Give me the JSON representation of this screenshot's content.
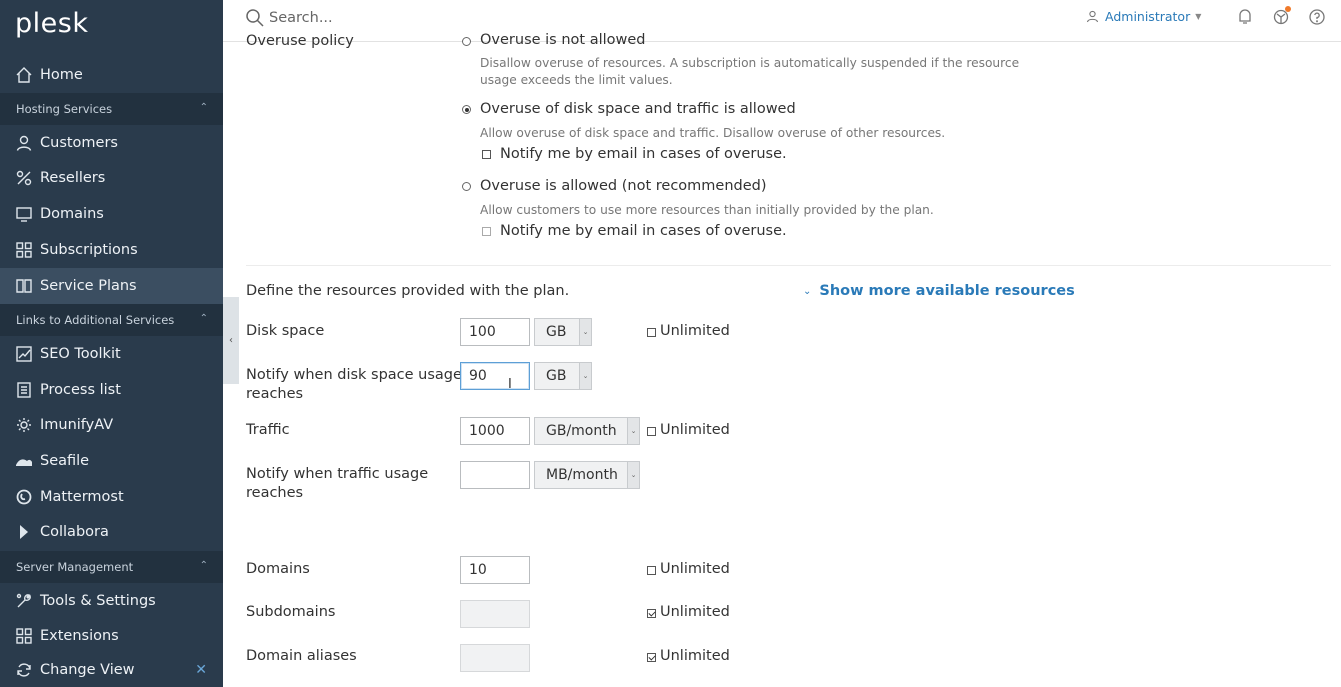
{
  "sidebar": {
    "logo": "plesk",
    "home": "Home",
    "group_hosting": "Hosting Services",
    "customers": "Customers",
    "resellers": "Resellers",
    "domains": "Domains",
    "subscriptions": "Subscriptions",
    "service_plans": "Service Plans",
    "group_links": "Links to Additional Services",
    "seo_toolkit": "SEO Toolkit",
    "process_list": "Process list",
    "imunifyav": "ImunifyAV",
    "seafile": "Seafile",
    "mattermost": "Mattermost",
    "collabora": "Collabora",
    "group_server": "Server Management",
    "tools_settings": "Tools & Settings",
    "extensions": "Extensions",
    "change_view": "Change View"
  },
  "header": {
    "search_placeholder": "Search...",
    "user": "Administrator"
  },
  "overuse": {
    "label": "Overuse policy",
    "opt1_title": "Overuse is not allowed",
    "opt1_desc1": "Disallow overuse of resources. A subscription is automatically suspended if the resource",
    "opt1_desc2": "usage exceeds the limit values.",
    "opt2_title": "Overuse of disk space and traffic is allowed",
    "opt2_desc": "Allow overuse of disk space and traffic. Disallow overuse of other resources.",
    "opt2_notify": "Notify me by email in cases of overuse.",
    "opt3_title": "Overuse is allowed (not recommended)",
    "opt3_desc": "Allow customers to use more resources than initially provided by the plan.",
    "opt3_notify": "Notify me by email in cases of overuse.",
    "selected": "opt2"
  },
  "resources": {
    "intro": "Define the resources provided with the plan.",
    "show_more": "Show more available resources",
    "disk_label": "Disk space",
    "disk_value": "100",
    "disk_unit": "GB",
    "notify_disk_label1": "Notify when disk space usage",
    "notify_disk_label2": "reaches",
    "notify_disk_value": "90",
    "notify_disk_unit": "GB",
    "traffic_label": "Traffic",
    "traffic_value": "1000",
    "traffic_unit": "GB/month",
    "notify_traffic_label1": "Notify when traffic usage",
    "notify_traffic_label2": "reaches",
    "notify_traffic_value": "",
    "notify_traffic_unit": "MB/month",
    "domains_label": "Domains",
    "domains_value": "10",
    "subdomains_label": "Subdomains",
    "aliases_label": "Domain aliases",
    "unlimited": "Unlimited"
  }
}
